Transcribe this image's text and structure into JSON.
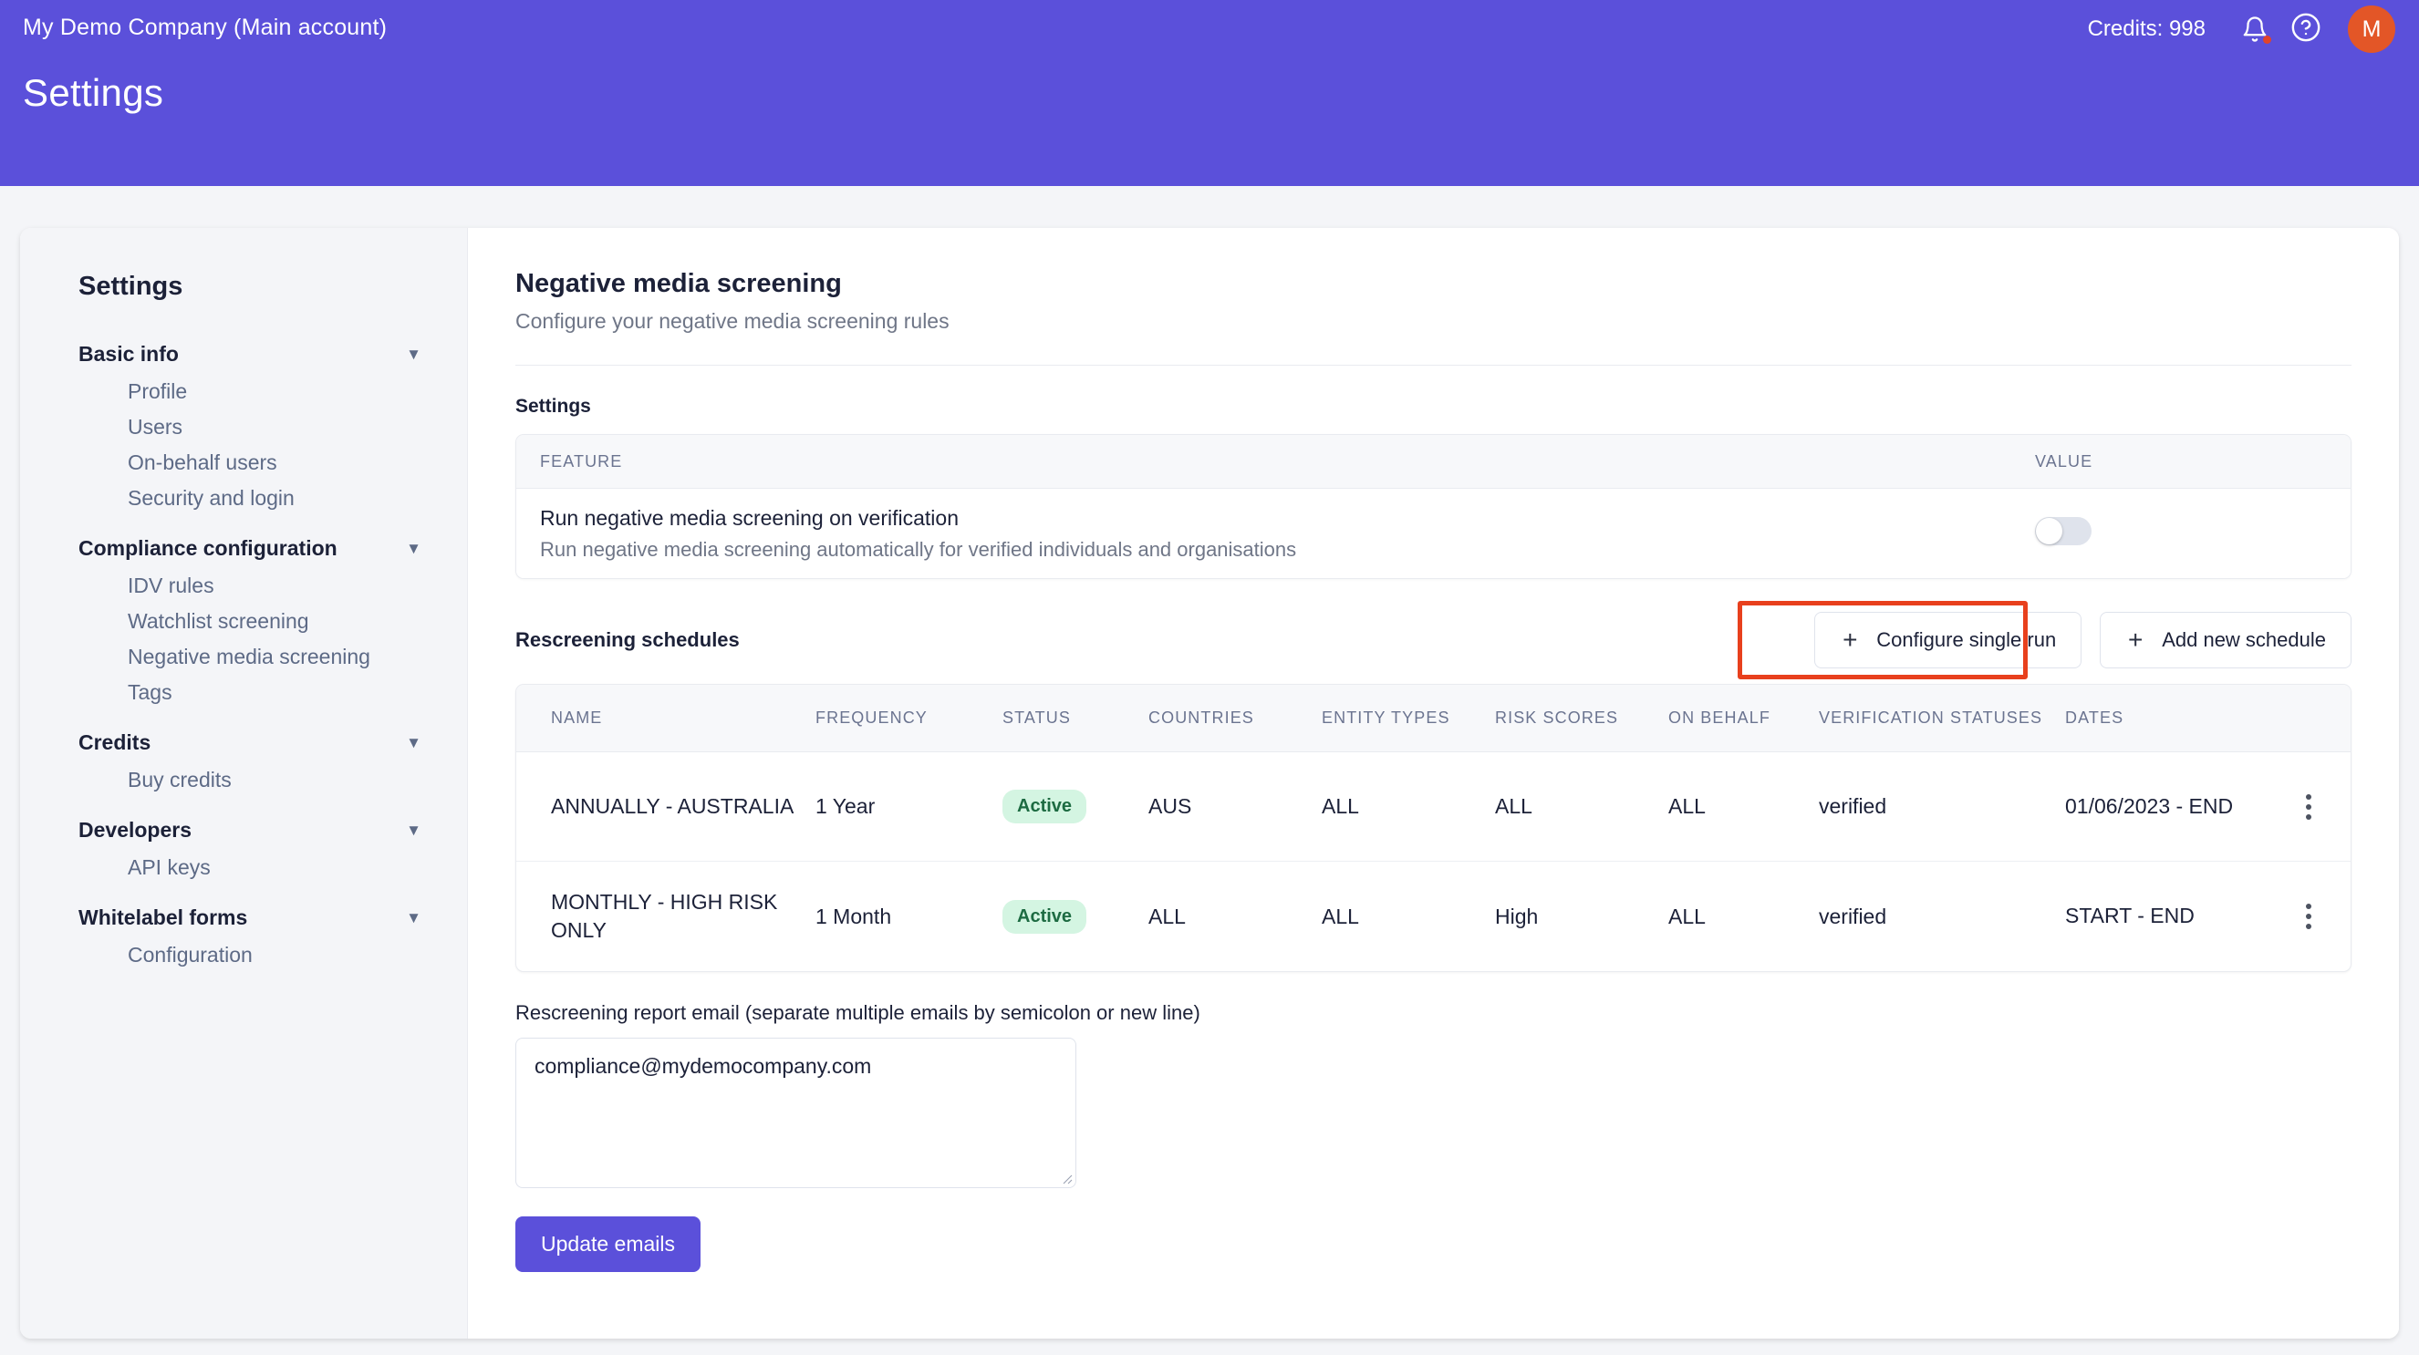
{
  "topbar": {
    "account": "My Demo Company (Main account)",
    "page_title": "Settings",
    "credits": "Credits: 998",
    "bell_icon": "bell-icon",
    "help_icon": "question-circle-icon",
    "avatar_initial": "M",
    "brand_color": "#5b50da",
    "avatar_color": "#e35627",
    "notification_dot_color": "#e0442b"
  },
  "sidebar": {
    "title": "Settings",
    "groups": [
      {
        "label": "Basic info",
        "items": [
          "Profile",
          "Users",
          "On-behalf users",
          "Security and login"
        ]
      },
      {
        "label": "Compliance configuration",
        "items": [
          "IDV rules",
          "Watchlist screening",
          "Negative media screening",
          "Tags"
        ]
      },
      {
        "label": "Credits",
        "items": [
          "Buy credits"
        ]
      },
      {
        "label": "Developers",
        "items": [
          "API keys"
        ]
      },
      {
        "label": "Whitelabel forms",
        "items": [
          "Configuration"
        ]
      }
    ]
  },
  "main": {
    "title": "Negative media screening",
    "subtitle": "Configure your negative media screening rules",
    "settings_label": "Settings",
    "feature_table": {
      "headers": {
        "feature": "FEATURE",
        "value": "VALUE"
      },
      "rows": [
        {
          "name": "Run negative media screening on verification",
          "description": "Run negative media screening automatically for verified individuals and organisations",
          "toggle_state": "off"
        }
      ]
    },
    "rescreening": {
      "label": "Rescreening schedules",
      "configure_single_run_label": "Configure single run",
      "add_new_schedule_label": "Add new schedule",
      "highlight_color": "#e8401d",
      "headers": [
        "NAME",
        "FREQUENCY",
        "STATUS",
        "COUNTRIES",
        "ENTITY TYPES",
        "RISK SCORES",
        "ON BEHALF",
        "VERIFICATION STATUSES",
        "DATES"
      ],
      "rows": [
        {
          "name": "ANNUALLY - AUSTRALIA",
          "frequency": "1 Year",
          "status": "Active",
          "countries": "AUS",
          "entity_types": "ALL",
          "risk_scores": "ALL",
          "on_behalf": "ALL",
          "verification_statuses": "verified",
          "dates": "01/06/2023 - END"
        },
        {
          "name": "MONTHLY - HIGH RISK ONLY",
          "frequency": "1 Month",
          "status": "Active",
          "countries": "ALL",
          "entity_types": "ALL",
          "risk_scores": "High",
          "on_behalf": "ALL",
          "verification_statuses": "verified",
          "dates": "START - END"
        }
      ],
      "badge_bg": "#d4f5e2",
      "badge_fg": "#1d6b42"
    },
    "email": {
      "label": "Rescreening report email (separate multiple emails by semicolon or new line)",
      "value": "compliance@mydemocompany.com",
      "placeholder": "",
      "button_label": "Update emails"
    }
  }
}
